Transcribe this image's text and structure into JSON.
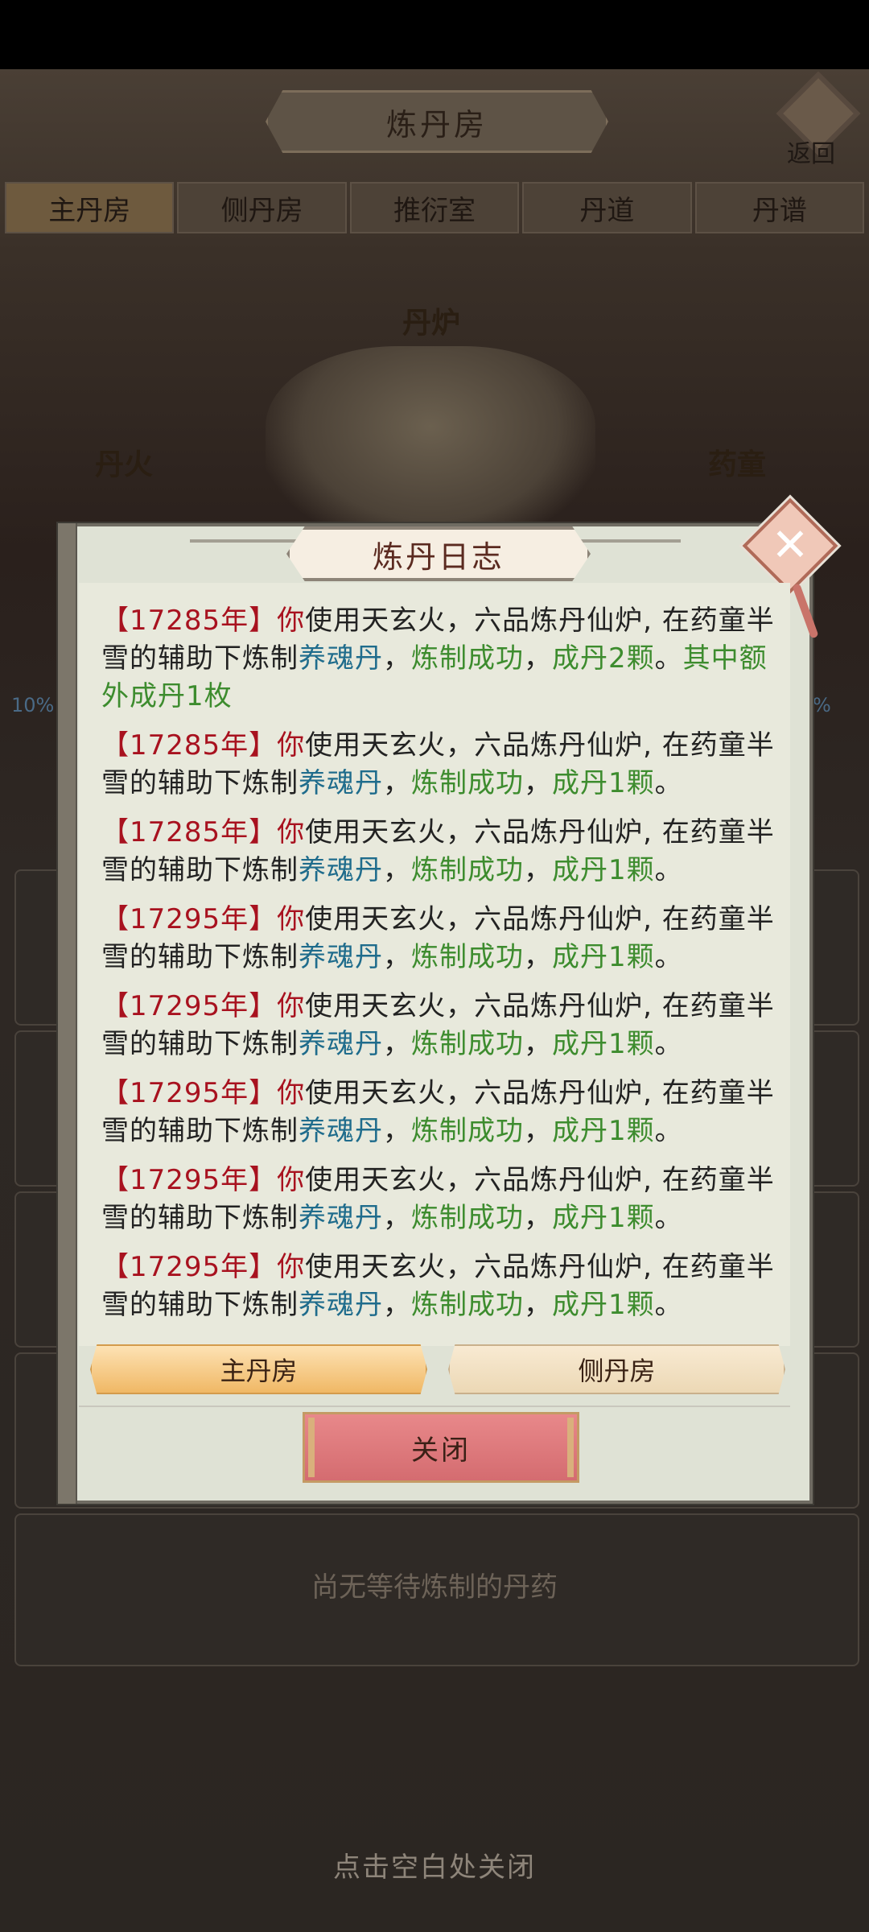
{
  "page": {
    "title": "炼丹房",
    "back_label": "返回",
    "tabs": [
      "主丹房",
      "侧丹房",
      "推衍室",
      "丹道",
      "丹谱"
    ],
    "furnace_label": "丹炉",
    "fire_label": "丹火",
    "boy_label": "药童",
    "side_left": "10%",
    "side_right": "%",
    "empty_text": "尚无等待炼制的丹药",
    "tap_close": "点击空白处关闭"
  },
  "dialog": {
    "title": "炼丹日志",
    "tab_main": "主丹房",
    "tab_side": "侧丹房",
    "close_label": "关闭",
    "log": [
      {
        "year": "【17285年】",
        "you": "你",
        "mid": "使用天玄火，六品炼丹仙炉, 在药童半雪的辅助下炼制",
        "dan": "养魂丹",
        "c1": "，",
        "ok": "炼制成功",
        "c2": "，",
        "res": "成丹2颗",
        "end": "。",
        "extra": "其中额外成丹1枚"
      },
      {
        "year": "【17285年】",
        "you": "你",
        "mid": "使用天玄火，六品炼丹仙炉, 在药童半雪的辅助下炼制",
        "dan": "养魂丹",
        "c1": "，",
        "ok": "炼制成功",
        "c2": "，",
        "res": "成丹1颗",
        "end": "。",
        "extra": ""
      },
      {
        "year": "【17285年】",
        "you": "你",
        "mid": "使用天玄火，六品炼丹仙炉, 在药童半雪的辅助下炼制",
        "dan": "养魂丹",
        "c1": "，",
        "ok": "炼制成功",
        "c2": "，",
        "res": "成丹1颗",
        "end": "。",
        "extra": ""
      },
      {
        "year": "【17295年】",
        "you": "你",
        "mid": "使用天玄火，六品炼丹仙炉, 在药童半雪的辅助下炼制",
        "dan": "养魂丹",
        "c1": "，",
        "ok": "炼制成功",
        "c2": "，",
        "res": "成丹1颗",
        "end": "。",
        "extra": ""
      },
      {
        "year": "【17295年】",
        "you": "你",
        "mid": "使用天玄火，六品炼丹仙炉, 在药童半雪的辅助下炼制",
        "dan": "养魂丹",
        "c1": "，",
        "ok": "炼制成功",
        "c2": "，",
        "res": "成丹1颗",
        "end": "。",
        "extra": ""
      },
      {
        "year": "【17295年】",
        "you": "你",
        "mid": "使用天玄火，六品炼丹仙炉, 在药童半雪的辅助下炼制",
        "dan": "养魂丹",
        "c1": "，",
        "ok": "炼制成功",
        "c2": "，",
        "res": "成丹1颗",
        "end": "。",
        "extra": ""
      },
      {
        "year": "【17295年】",
        "you": "你",
        "mid": "使用天玄火，六品炼丹仙炉, 在药童半雪的辅助下炼制",
        "dan": "养魂丹",
        "c1": "，",
        "ok": "炼制成功",
        "c2": "，",
        "res": "成丹1颗",
        "end": "。",
        "extra": ""
      },
      {
        "year": "【17295年】",
        "you": "你",
        "mid": "使用天玄火，六品炼丹仙炉, 在药童半雪的辅助下炼制",
        "dan": "养魂丹",
        "c1": "，",
        "ok": "炼制成功",
        "c2": "，",
        "res": "成丹1颗",
        "end": "。",
        "extra": ""
      }
    ]
  },
  "colors": {
    "year": "#a8121f",
    "pill": "#1f6c8c",
    "success": "#3d8c2e",
    "close_button": "#d46c70"
  }
}
